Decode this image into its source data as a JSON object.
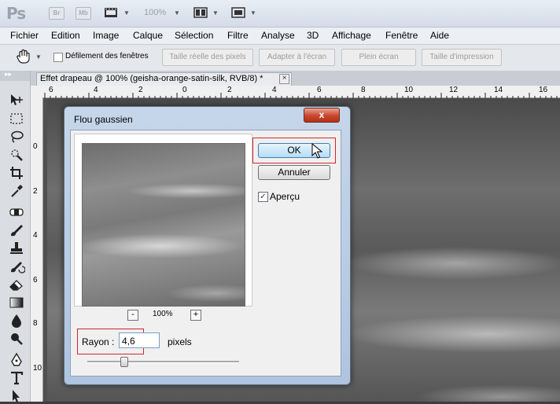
{
  "app": {
    "logo": "Ps",
    "bridge_tile": "Br",
    "minibridge_tile": "Mb",
    "zoom_level": "100%"
  },
  "menu": [
    "Fichier",
    "Edition",
    "Image",
    "Calque",
    "Sélection",
    "Filtre",
    "Analyse",
    "3D",
    "Affichage",
    "Fenêtre",
    "Aide"
  ],
  "options_bar": {
    "scroll_all_label": "Défilement des fenêtres",
    "actual_pixels": "Taille réelle des pixels",
    "fit_screen": "Adapter à l'écran",
    "fill_screen": "Plein écran",
    "print_size": "Taille d'impression"
  },
  "document_tab": {
    "title": "Effet drapeau @ 100% (geisha-orange-satin-silk, RVB/8) *",
    "close": "×"
  },
  "rulers": {
    "horizontal": [
      "6",
      "4",
      "2",
      "0",
      "2",
      "4",
      "6",
      "8",
      "10",
      "12",
      "14",
      "16"
    ],
    "vertical": [
      "0",
      "2",
      "4",
      "6",
      "8",
      "10"
    ]
  },
  "dialog": {
    "title": "Flou gaussien",
    "close": "x",
    "zoom_out": "-",
    "zoom_percent": "100%",
    "zoom_in": "+",
    "ok": "OK",
    "cancel": "Annuler",
    "preview_label": "Aperçu",
    "preview_checked": true,
    "radius_label": "Rayon :",
    "radius_value": "4,6",
    "radius_unit": "pixels"
  },
  "colors": {
    "highlight_red": "#d2262c",
    "ok_border": "#3c7fb1",
    "close_red": "#c9462d"
  }
}
